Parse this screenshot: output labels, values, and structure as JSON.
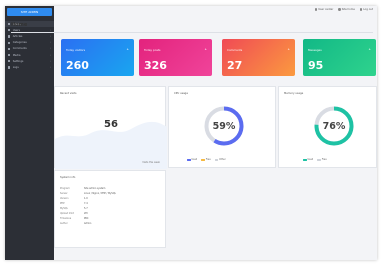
{
  "sidebar": {
    "brand": "SITE ADMIN",
    "items": [
      {
        "label": "Home",
        "active": true
      },
      {
        "label": "Users"
      },
      {
        "label": "Articles"
      },
      {
        "label": "Categories"
      },
      {
        "label": "Comments"
      },
      {
        "label": "Media"
      },
      {
        "label": "Settings"
      },
      {
        "label": "Logs"
      }
    ]
  },
  "topbar": {
    "links": [
      "User center",
      "Site home",
      "Log out"
    ]
  },
  "page": {
    "title": "Home"
  },
  "stats": [
    {
      "label": "Today visitors",
      "badge": "+",
      "value": "260",
      "color_from": "#2b6ff2",
      "color_to": "#19a6f0"
    },
    {
      "label": "Today posts",
      "badge": "+",
      "value": "326",
      "color_from": "#e3237d",
      "color_to": "#f0449a"
    },
    {
      "label": "Comments",
      "badge": "+",
      "value": "27",
      "color_from": "#f04a55",
      "color_to": "#fb9a3f"
    },
    {
      "label": "Messages",
      "badge": "+",
      "value": "95",
      "color_from": "#12b886",
      "color_to": "#2fd38d"
    }
  ],
  "visits_card": {
    "title": "Recent visits",
    "value": "56",
    "footer": "Visits this week"
  },
  "cpu_card": {
    "title": "CPU usage",
    "percent": 59,
    "percent_label": "59%",
    "ring_color": "#5b6cf0",
    "legend": [
      {
        "label": "Used",
        "color": "#5b6cf0"
      },
      {
        "label": "Free",
        "color": "#f5b941"
      },
      {
        "label": "Other",
        "color": "#cfd3da"
      }
    ]
  },
  "mem_card": {
    "title": "Memory usage",
    "percent": 76,
    "percent_label": "76%",
    "ring_color": "#1ec2a4",
    "legend": [
      {
        "label": "Used",
        "color": "#1ec2a4"
      },
      {
        "label": "Free",
        "color": "#cfd3da"
      }
    ]
  },
  "info_card": {
    "title": "System info",
    "rows": [
      {
        "k": "Program",
        "v": "Site admin system"
      },
      {
        "k": "Server",
        "v": "Linux / Nginx / PHP / MySQL"
      },
      {
        "k": "Version",
        "v": "1.0"
      },
      {
        "k": "PHP",
        "v": "7.4"
      },
      {
        "k": "MySQL",
        "v": "5.7"
      },
      {
        "k": "Upload limit",
        "v": "2M"
      },
      {
        "k": "Timezone",
        "v": "PRC"
      },
      {
        "k": "Author",
        "v": "Admin"
      }
    ]
  }
}
